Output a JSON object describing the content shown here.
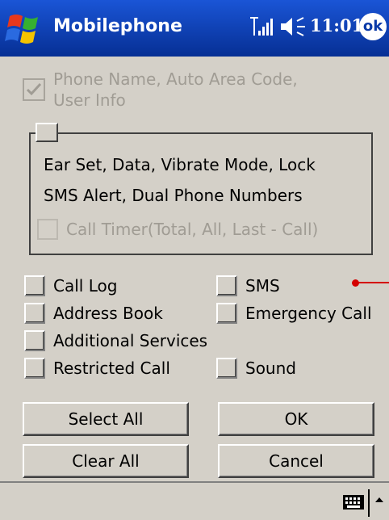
{
  "titlebar": {
    "start_icon": "windows-flag-icon",
    "title": "Mobilephone",
    "signal_icon": "signal-strength-icon",
    "volume_icon": "speaker-icon",
    "time": "11:01",
    "ok_label": "ok"
  },
  "top_option": {
    "label_line1": "Phone Name, Auto Area Code,",
    "label_line2": "User Info",
    "checked": true,
    "disabled": true
  },
  "group": {
    "line1": "Ear Set, Data, Vibrate Mode,  Lock",
    "line2": "SMS Alert, Dual Phone Numbers",
    "call_timer_label": "Call Timer(Total, All, Last - Call)"
  },
  "options_left": [
    "Call Log",
    "Address Book",
    "Additional Services",
    "Restricted Call"
  ],
  "options_right": [
    "SMS",
    "Emergency Call",
    "Sound"
  ],
  "buttons": {
    "select_all": "Select All",
    "ok": "OK",
    "clear_all": "Clear All",
    "cancel": "Cancel"
  },
  "bottom": {
    "keyboard_icon": "keyboard-icon",
    "sip_arrow_icon": "up-arrow-icon"
  },
  "colors": {
    "titlebar": "#0a3aa8",
    "background": "#d4d0c8",
    "annotation": "#d40000"
  }
}
